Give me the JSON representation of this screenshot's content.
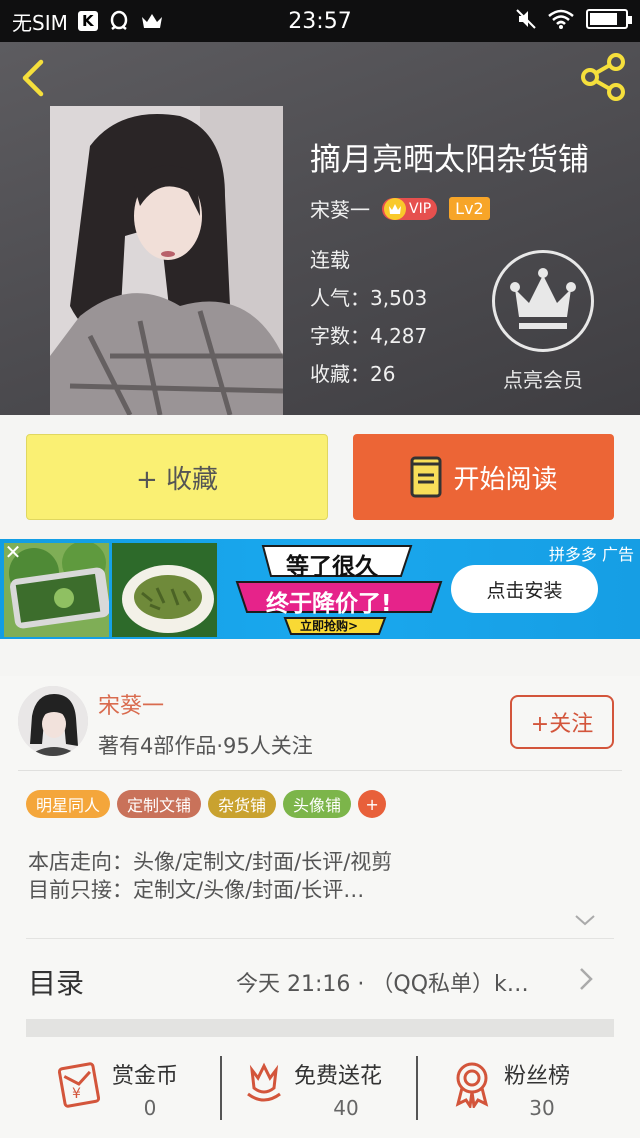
{
  "status_bar": {
    "carrier": "无SIM",
    "time": "23:57"
  },
  "header": {
    "book_title": "摘月亮晒太阳杂货铺",
    "author": "宋葵一",
    "vip_label": "VIP",
    "level": "Lv2",
    "status": "连载",
    "popularity": "人气：3,503",
    "word_count": "字数：4,287",
    "favorites": "收藏：26",
    "member_label": "点亮会员"
  },
  "actions": {
    "collect_label": "+ 收藏",
    "read_label": "开始阅读"
  },
  "ad": {
    "slogan_line1": "等了很久",
    "slogan_line2": "终于降价了!",
    "slogan_button": "立即抢购>",
    "sponsor": "拼多多  广告",
    "install_label": "点击安装"
  },
  "author_section": {
    "name": "宋葵一",
    "works_info": "著有4部作品·95人关注",
    "follow_label": "+关注",
    "tags": [
      {
        "label": "明星同人",
        "color": "#f4a63b"
      },
      {
        "label": "定制文铺",
        "color": "#c9725a"
      },
      {
        "label": "杂货铺",
        "color": "#c9a22f"
      },
      {
        "label": "头像铺",
        "color": "#7cb54a"
      }
    ],
    "tag_add": "+",
    "tag_add_color": "#e8603a",
    "desc_line1": "本店走向：头像/定制文/封面/长评/视剪",
    "desc_line2": "目前只接：定制文/头像/封面/长评…",
    "toc_title": "目录",
    "toc_latest": "今天 21:16 · （QQ私单）k…"
  },
  "stats": {
    "reward_label": "赏金币",
    "reward_value": "0",
    "flower_label": "免费送花",
    "flower_value": "40",
    "fans_label": "粉丝榜",
    "fans_value": "30"
  },
  "colors": {
    "accent_orange": "#ec6536",
    "collect_yellow": "#faf073",
    "icon_red": "#d3553b"
  }
}
